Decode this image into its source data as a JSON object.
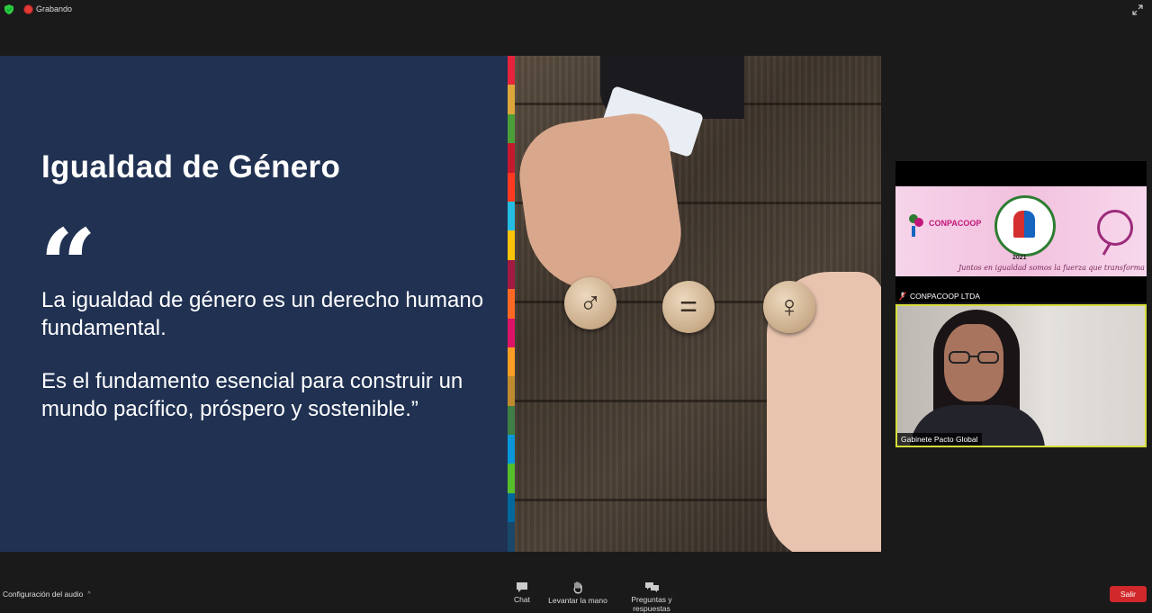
{
  "top_bar": {
    "recording_label": "Grabando"
  },
  "slide": {
    "title": "Igualdad de Género",
    "quote_mark": "“",
    "paragraph1": "La igualdad de género es un derecho humano fundamental.",
    "paragraph2": "Es el fundamento esencial para construir un mundo pacífico, próspero y sostenible.”",
    "photo_tokens": [
      "♂",
      "=",
      "♀"
    ],
    "sdg_colors": [
      "#e5243b",
      "#dda63a",
      "#4c9f38",
      "#c5192d",
      "#ff3a21",
      "#26bde2",
      "#fcc30b",
      "#a21942",
      "#fd6925",
      "#dd1367",
      "#fd9d24",
      "#bf8b2e",
      "#3f7e44",
      "#0a97d9",
      "#56c02b",
      "#00689d",
      "#19486a"
    ]
  },
  "participants": [
    {
      "name": "CONPACOOP LTDA",
      "muted": true,
      "banner": {
        "brand": "CONPACOOP",
        "year": "2021",
        "motto": "Juntos en igualdad somos la fuerza que transforma"
      }
    },
    {
      "name": "Gabinete Pacto Global",
      "active_speaker": true
    }
  ],
  "toolbar": {
    "audio_config": "Configuración del audio",
    "chat": "Chat",
    "raise_hand": "Levantar la mano",
    "qa": "Preguntas y respuestas",
    "leave": "Salir"
  },
  "colors": {
    "slide_bg": "#203152",
    "active_speaker_border": "#d6dd3a",
    "leave_button": "#d0282b"
  }
}
